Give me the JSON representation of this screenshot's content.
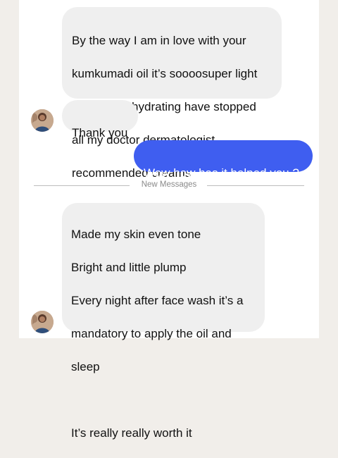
{
  "colors": {
    "page_background": "#f1eeea",
    "panel_background": "#ffffff",
    "incoming_bubble": "#efefef",
    "outgoing_bubble": "#3f5ef0",
    "divider": "#bdbdbd"
  },
  "messages": [
    {
      "direction": "incoming",
      "lines": [
        "By the way I am in love with your",
        "kumkumadi oil it’s soooosuper light",
        "and damm hydrating have stopped",
        "all my doctor dermatologist",
        "recommended creams"
      ]
    },
    {
      "direction": "incoming",
      "lines": [
        "Thank you"
      ],
      "avatar": "avatar-icon"
    },
    {
      "direction": "outgoing",
      "lines": [
        "Wow how has it helped you ?"
      ]
    },
    {
      "divider_label": "New Messages"
    },
    {
      "direction": "incoming",
      "lines": [
        "Made my skin even tone",
        "Bright and little plump",
        "Every night after face wash it’s a",
        "mandatory to apply the oil and",
        "sleep",
        "",
        "It’s really really worth it"
      ],
      "avatar": "avatar-icon"
    }
  ]
}
